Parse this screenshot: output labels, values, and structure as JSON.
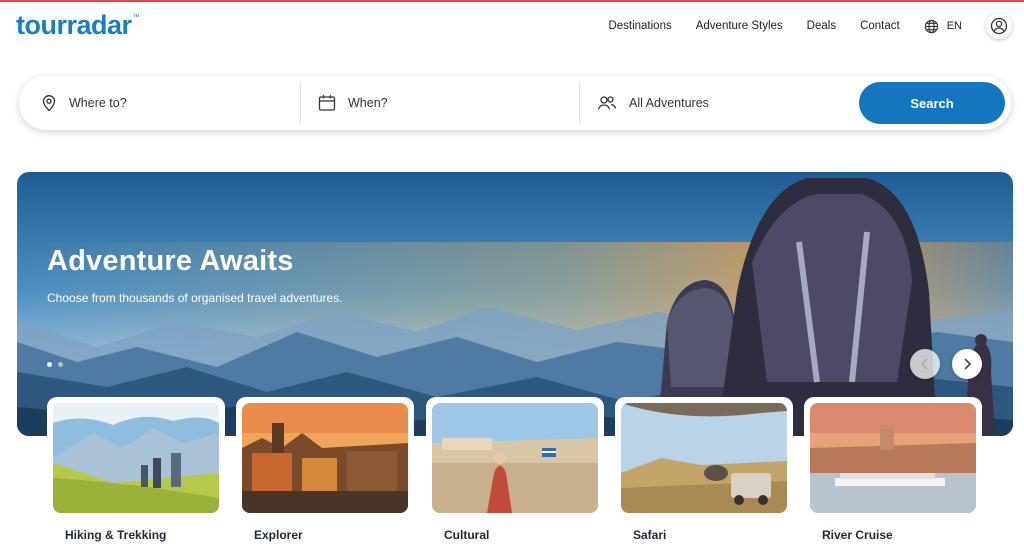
{
  "header": {
    "logo": "tourradar",
    "logo_tm": "™",
    "nav": [
      "Destinations",
      "Adventure Styles",
      "Deals",
      "Contact"
    ],
    "language": "EN"
  },
  "search": {
    "where_placeholder": "Where to?",
    "when_placeholder": "When?",
    "adventures_value": "All Adventures",
    "button_label": "Search"
  },
  "hero": {
    "title": "Adventure Awaits",
    "subtitle": "Choose from thousands of organised travel adventures."
  },
  "categories": [
    {
      "label": "Hiking & Trekking"
    },
    {
      "label": "Explorer"
    },
    {
      "label": "Cultural"
    },
    {
      "label": "Safari"
    },
    {
      "label": "River Cruise"
    }
  ],
  "icons": {
    "where": "location-pin-icon",
    "when": "calendar-icon",
    "adventures": "people-icon",
    "language": "globe-icon",
    "account": "user-circle-icon",
    "prev": "chevron-left-icon",
    "next": "chevron-right-icon"
  },
  "colors": {
    "brand": "#1a7fc1",
    "search_button": "#1576c0",
    "top_line": "#e5484d"
  }
}
